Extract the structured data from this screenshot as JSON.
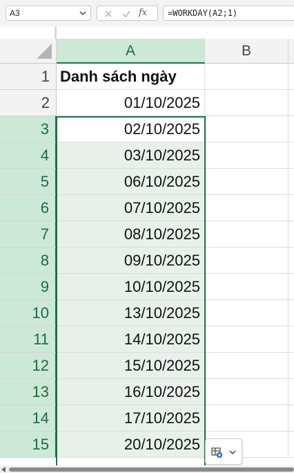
{
  "formula_bar": {
    "name_box": "A3",
    "fx_label": "fx",
    "formula": "=WORKDAY(A2;1)"
  },
  "columns": [
    "A",
    "B"
  ],
  "rows": [
    {
      "num": "1",
      "a": "Danh sách ngày"
    },
    {
      "num": "2",
      "a": "01/10/2025"
    },
    {
      "num": "3",
      "a": "02/10/2025"
    },
    {
      "num": "4",
      "a": "03/10/2025"
    },
    {
      "num": "5",
      "a": "06/10/2025"
    },
    {
      "num": "6",
      "a": "07/10/2025"
    },
    {
      "num": "7",
      "a": "08/10/2025"
    },
    {
      "num": "8",
      "a": "09/10/2025"
    },
    {
      "num": "9",
      "a": "10/10/2025"
    },
    {
      "num": "10",
      "a": "13/10/2025"
    },
    {
      "num": "11",
      "a": "14/10/2025"
    },
    {
      "num": "12",
      "a": "15/10/2025"
    },
    {
      "num": "13",
      "a": "16/10/2025"
    },
    {
      "num": "14",
      "a": "17/10/2025"
    },
    {
      "num": "15",
      "a": "20/10/2025"
    }
  ],
  "selection": {
    "active_cell": "A3",
    "first_row": 3,
    "last_row": 15
  },
  "colors": {
    "accent": "#1e7145",
    "selection_fill": "#e7f1ea",
    "header_selected": "#cbe9d6"
  },
  "quick_analysis": {
    "icon": "quick-analysis-icon"
  }
}
